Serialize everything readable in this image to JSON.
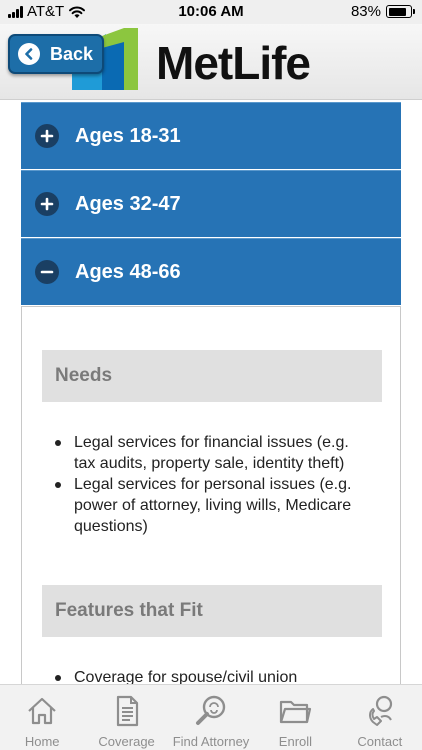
{
  "status_bar": {
    "carrier": "AT&T",
    "time": "10:06 AM",
    "battery": "83%",
    "battery_level": 0.83
  },
  "header": {
    "back_label": "Back",
    "logo_text": "MetLife",
    "brand_colors": [
      "#1f9bd7",
      "#8cc63f",
      "#0a6ab3"
    ]
  },
  "accordion": {
    "items": [
      {
        "label": "Ages 18-31",
        "icon": "plus-icon"
      },
      {
        "label": "Ages 32-47",
        "icon": "plus-icon"
      },
      {
        "label": "Ages 48-66",
        "icon": "minus-icon"
      }
    ],
    "accent_color": "#2673b5"
  },
  "panel": {
    "needs_title": "Needs",
    "needs_items": [
      "Legal services for financial issues (e.g. tax audits, property sale, identity theft)",
      "Legal services for personal issues (e.g. power of attorney, living wills, Medicare questions)"
    ],
    "features_title": "Features that Fit",
    "features_items": [
      "Coverage for spouse/civil union"
    ]
  },
  "tab_bar": {
    "tabs": [
      {
        "label": "Home",
        "icon": "home-icon"
      },
      {
        "label": "Coverage",
        "icon": "document-icon"
      },
      {
        "label": "Find Attorney",
        "icon": "search-icon"
      },
      {
        "label": "Enroll",
        "icon": "folder-icon"
      },
      {
        "label": "Contact",
        "icon": "contact-icon"
      }
    ]
  }
}
